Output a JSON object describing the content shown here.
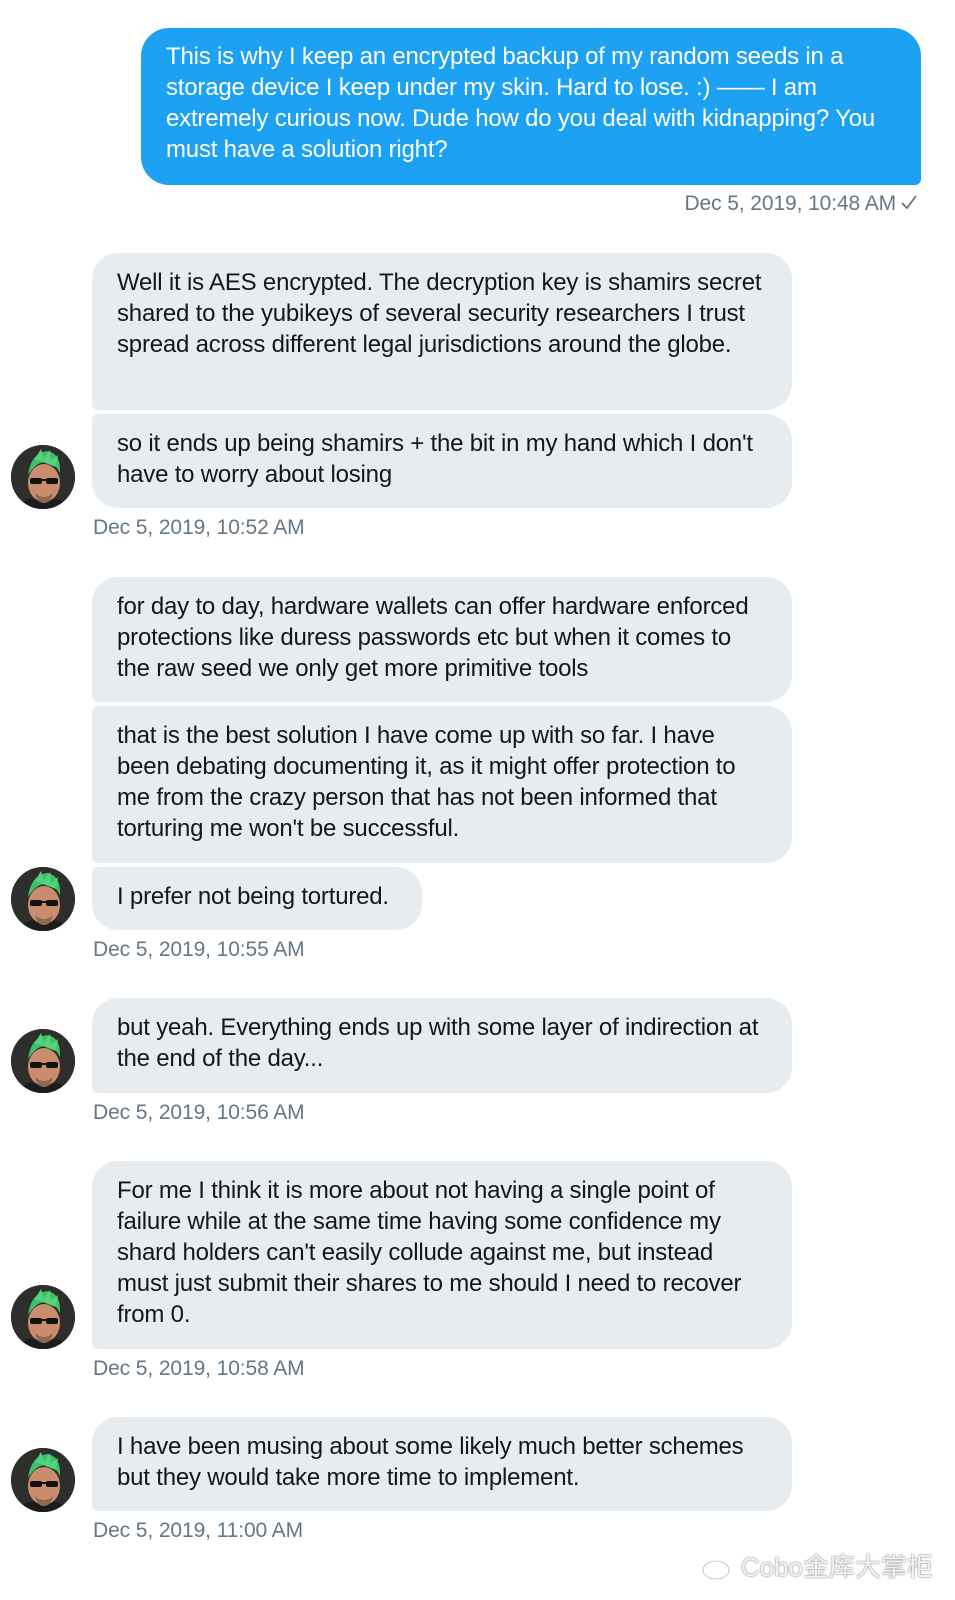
{
  "messages": {
    "sent_1": "This is why I keep an encrypted backup of my random seeds in a storage device I keep under my skin. Hard to lose. :) —— I am extremely curious now. Dude how do you deal with kidnapping? You must have a solution right?",
    "recv_1": "Well it is AES encrypted. The decryption key is shamirs secret shared to the yubikeys of several security researchers I trust spread across different legal jurisdictions around the globe.",
    "recv_2": "so it ends up being shamirs + the bit in my hand which I don't have to worry about losing",
    "recv_3": "for day to day, hardware wallets can offer hardware enforced protections like duress passwords etc but when it comes to the raw seed we only get more primitive tools",
    "recv_4": "that is the best solution I have come up with so far. I have been debating documenting it, as it might offer protection to me from the crazy person that has not been informed that torturing me won't be successful.",
    "recv_5": "I prefer not being tortured.",
    "recv_6": "but yeah. Everything ends up with some layer of indirection at the end of the day...",
    "recv_7": "For me I think it is more about not having a single point of failure while at the same time having some confidence my shard holders can't easily collude against me, but instead must just submit their shares to me should I need to recover from 0.",
    "recv_8": "I have been musing about some likely much better schemes but they would take more time to implement."
  },
  "timestamps": {
    "t1": "Dec 5, 2019, 10:48 AM",
    "t2": "Dec 5, 2019, 10:52 AM",
    "t3": "Dec 5, 2019, 10:55 AM",
    "t4": "Dec 5, 2019, 10:56 AM",
    "t5": "Dec 5, 2019, 10:58 AM",
    "t6": "Dec 5, 2019, 11:00 AM"
  },
  "watermark": {
    "text": "Cobo金库大掌柜",
    "icon": "weibo-icon"
  },
  "icons": {
    "read_receipt": "check-icon",
    "avatar": "avatar-green-mohawk"
  },
  "colors": {
    "sent_bubble": "#1da1f2",
    "received_bubble": "#e6ecf0",
    "timestamp": "#657786"
  }
}
